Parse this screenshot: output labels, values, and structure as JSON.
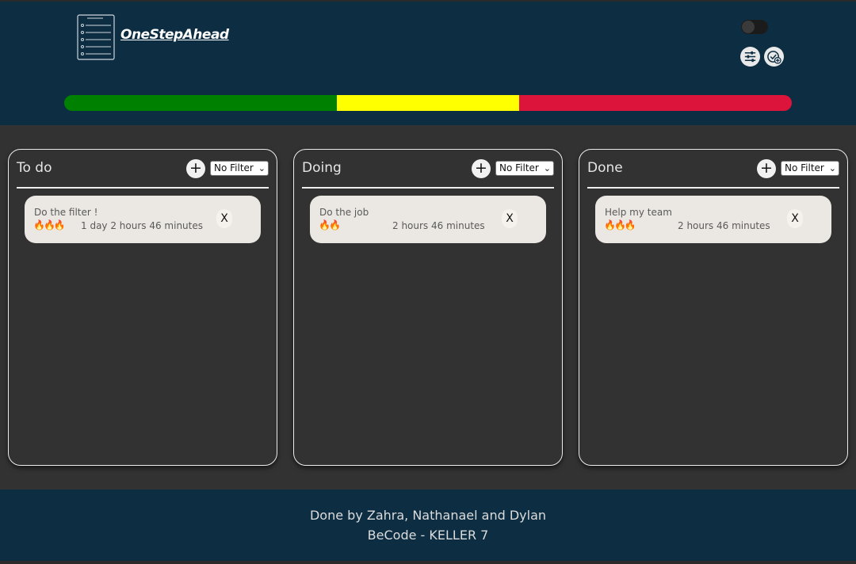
{
  "header": {
    "logo_text": "OneStepAhead",
    "logo_icon": "notepad-checklist-icon",
    "theme_toggle_icon": "toggle-switch-icon",
    "filter_icon": "sliders-icon",
    "add_task_icon": "check-plus-icon"
  },
  "progress": {
    "segments": [
      {
        "name": "To do",
        "fraction": 0.375,
        "color": "#008000"
      },
      {
        "name": "Doing",
        "fraction": 0.25,
        "color": "#ffff00"
      },
      {
        "name": "Done",
        "fraction": 0.375,
        "color": "#dc143c"
      }
    ]
  },
  "columns": [
    {
      "title": "To do",
      "add_label": "+",
      "filter_value": "No Filter",
      "cards": [
        {
          "title": "Do the filter !",
          "flames": "🔥🔥🔥",
          "time": "1 day 2 hours 46 minutes",
          "close_label": "X"
        }
      ]
    },
    {
      "title": "Doing",
      "add_label": "+",
      "filter_value": "No Filter",
      "cards": [
        {
          "title": "Do the job",
          "flames": "🔥🔥",
          "time": "2 hours 46 minutes",
          "close_label": "X"
        }
      ]
    },
    {
      "title": "Done",
      "add_label": "+",
      "filter_value": "No Filter",
      "cards": [
        {
          "title": "Help my team",
          "flames": "🔥🔥🔥",
          "time": "2 hours 46 minutes",
          "close_label": "X"
        }
      ]
    }
  ],
  "footer": {
    "line1": "Done by Zahra, Nathanael and Dylan",
    "line2": "BeCode - KELLER 7"
  }
}
